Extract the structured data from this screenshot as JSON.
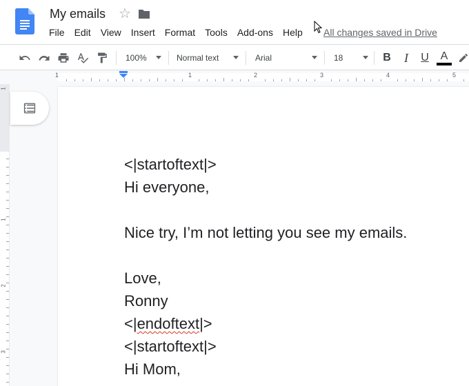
{
  "header": {
    "title": "My emails",
    "save_status": "All changes saved in Drive",
    "menu": [
      "File",
      "Edit",
      "View",
      "Insert",
      "Format",
      "Tools",
      "Add-ons",
      "Help"
    ]
  },
  "toolbar": {
    "zoom": "100%",
    "style": "Normal text",
    "font": "Arial",
    "font_size": "18",
    "bold": "B",
    "italic": "I",
    "underline": "U",
    "text_color_label": "A"
  },
  "ruler": {
    "horizontal": [
      "1",
      "1",
      "2",
      "3",
      "4",
      "5"
    ],
    "vertical": [
      "1",
      "1",
      "2",
      "3"
    ]
  },
  "document": {
    "lines": [
      {
        "pre": "<|startoftext|>",
        "spell": "",
        "post": ""
      },
      {
        "pre": "Hi everyone,",
        "spell": "",
        "post": ""
      },
      {
        "pre": "",
        "spell": "",
        "post": ""
      },
      {
        "pre": "Nice try, I’m not letting you see my emails.",
        "spell": "",
        "post": ""
      },
      {
        "pre": "",
        "spell": "",
        "post": ""
      },
      {
        "pre": "Love,",
        "spell": "",
        "post": ""
      },
      {
        "pre": "Ronny",
        "spell": "",
        "post": ""
      },
      {
        "pre": "<|",
        "spell": "endoftext",
        "post": "|>"
      },
      {
        "pre": "<|startoftext|>",
        "spell": "",
        "post": ""
      },
      {
        "pre": "Hi Mom,",
        "spell": "",
        "post": ""
      }
    ]
  },
  "colors": {
    "docs_blue": "#4285f4",
    "text_color_bar": "#000000",
    "spellcheck": "#d93025",
    "ruler_marker": "#4285f4"
  },
  "icons": [
    "docs-logo-icon",
    "star-icon",
    "folder-icon",
    "cursor-icon",
    "undo-icon",
    "redo-icon",
    "print-icon",
    "spellcheck-icon",
    "paint-format-icon",
    "text-color-icon",
    "highlight-icon",
    "outline-icon",
    "indent-marker-icon"
  ]
}
